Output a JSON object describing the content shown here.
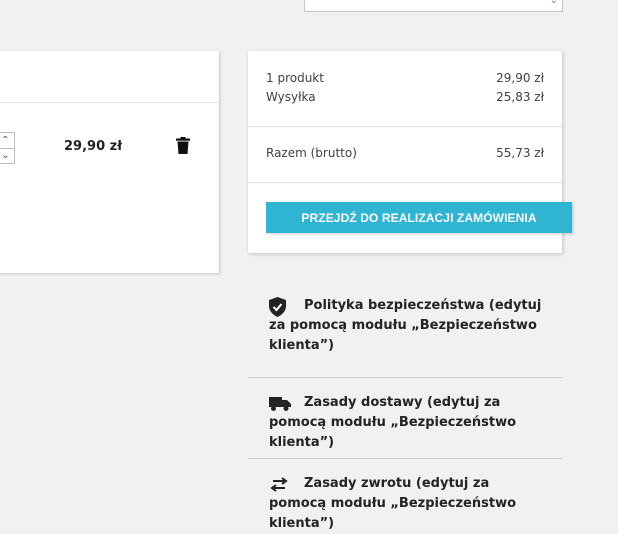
{
  "cart_line": {
    "price": "29,90 zł",
    "qty_up": "⌃",
    "qty_down": "⌄"
  },
  "summary": {
    "products_label": "1 produkt",
    "products_value": "29,90 zł",
    "shipping_label": "Wysyłka",
    "shipping_value": "25,83 zł",
    "total_label": "Razem (brutto)",
    "total_value": "55,73 zł",
    "checkout_label": "PRZEJDŹ DO REALIZACJI ZAMÓWIENIA"
  },
  "reassurance": [
    {
      "icon": "shield-check-icon",
      "text": "Polityka bezpieczeństwa (edytuj za pomocą modułu „Bezpieczeństwo klienta”)"
    },
    {
      "icon": "truck-icon",
      "text": "Zasady dostawy (edytuj za pomocą modułu „Bezpieczeństwo klienta”)"
    },
    {
      "icon": "swap-arrows-icon",
      "text": "Zasady zwrotu (edytuj za pomocą modułu „Bezpieczeństwo klienta”)"
    }
  ],
  "colors": {
    "accent": "#2fb5d2",
    "background": "#f1f1f1"
  }
}
